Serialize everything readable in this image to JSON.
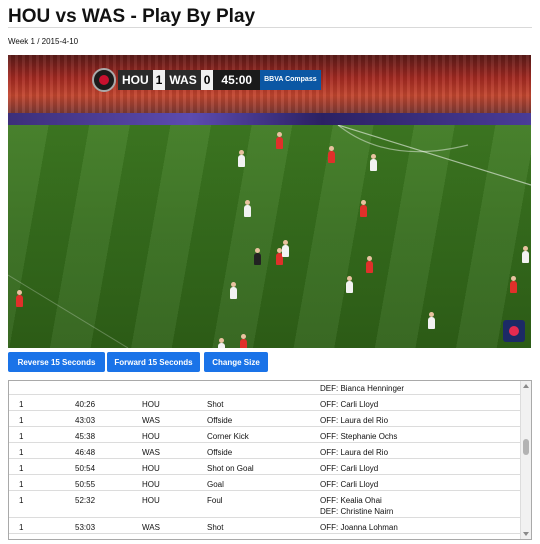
{
  "page": {
    "title": "HOU vs WAS - Play By Play",
    "subtitle": "Week 1 / 2015-4-10"
  },
  "video": {
    "scoreboard": {
      "home_team": "HOU",
      "home_score": "1",
      "away_team": "WAS",
      "away_score": "0",
      "clock": "45:00",
      "sponsor": "BBVA Compass"
    }
  },
  "controls": {
    "reverse_label": "Reverse 15 Seconds",
    "forward_label": "Forward 15 Seconds",
    "size_label": "Change Size"
  },
  "plays": [
    {
      "period": "",
      "time": "",
      "team": "",
      "event": "",
      "players": [
        "DEF: Bianca Henninger"
      ]
    },
    {
      "period": "1",
      "time": "40:26",
      "team": "HOU",
      "event": "Shot",
      "players": [
        "OFF: Carli Lloyd"
      ]
    },
    {
      "period": "1",
      "time": "43:03",
      "team": "WAS",
      "event": "Offside",
      "players": [
        "OFF: Laura del Rio"
      ]
    },
    {
      "period": "1",
      "time": "45:38",
      "team": "HOU",
      "event": "Corner Kick",
      "players": [
        "OFF: Stephanie Ochs"
      ]
    },
    {
      "period": "1",
      "time": "46:48",
      "team": "WAS",
      "event": "Offside",
      "players": [
        "OFF: Laura del Rio"
      ]
    },
    {
      "period": "1",
      "time": "50:54",
      "team": "HOU",
      "event": "Shot on Goal",
      "players": [
        "OFF: Carli Lloyd"
      ]
    },
    {
      "period": "1",
      "time": "50:55",
      "team": "HOU",
      "event": "Goal",
      "players": [
        "OFF: Carli Lloyd"
      ]
    },
    {
      "period": "1",
      "time": "52:32",
      "team": "HOU",
      "event": "Foul",
      "players": [
        "OFF: Kealia Ohai",
        "DEF: Christine Nairn"
      ]
    },
    {
      "period": "1",
      "time": "53:03",
      "team": "WAS",
      "event": "Shot",
      "players": [
        "OFF: Joanna Lohman"
      ]
    }
  ]
}
